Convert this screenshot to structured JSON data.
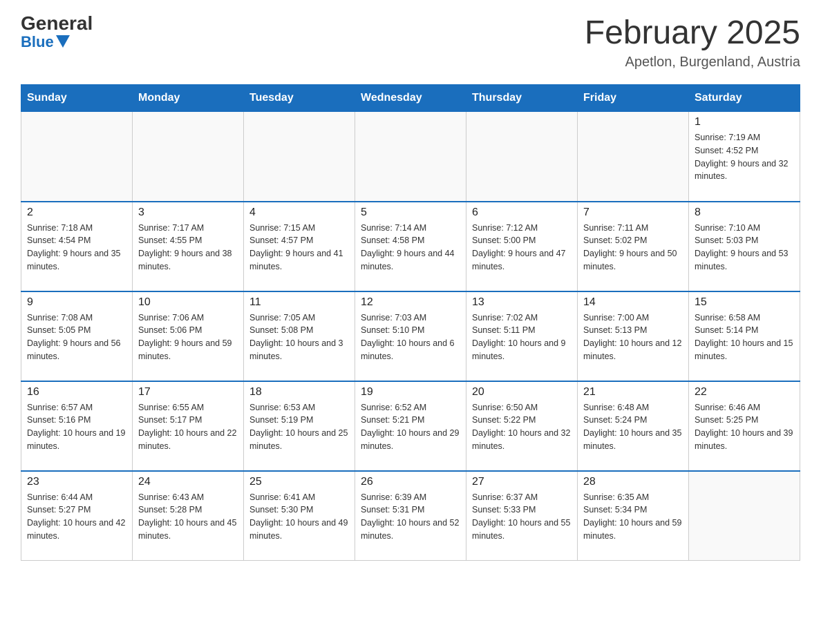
{
  "header": {
    "logo_general": "General",
    "logo_blue": "Blue",
    "month_title": "February 2025",
    "location": "Apetlon, Burgenland, Austria"
  },
  "days_of_week": [
    "Sunday",
    "Monday",
    "Tuesday",
    "Wednesday",
    "Thursday",
    "Friday",
    "Saturday"
  ],
  "weeks": [
    [
      {
        "day": "",
        "info": ""
      },
      {
        "day": "",
        "info": ""
      },
      {
        "day": "",
        "info": ""
      },
      {
        "day": "",
        "info": ""
      },
      {
        "day": "",
        "info": ""
      },
      {
        "day": "",
        "info": ""
      },
      {
        "day": "1",
        "info": "Sunrise: 7:19 AM\nSunset: 4:52 PM\nDaylight: 9 hours and 32 minutes."
      }
    ],
    [
      {
        "day": "2",
        "info": "Sunrise: 7:18 AM\nSunset: 4:54 PM\nDaylight: 9 hours and 35 minutes."
      },
      {
        "day": "3",
        "info": "Sunrise: 7:17 AM\nSunset: 4:55 PM\nDaylight: 9 hours and 38 minutes."
      },
      {
        "day": "4",
        "info": "Sunrise: 7:15 AM\nSunset: 4:57 PM\nDaylight: 9 hours and 41 minutes."
      },
      {
        "day": "5",
        "info": "Sunrise: 7:14 AM\nSunset: 4:58 PM\nDaylight: 9 hours and 44 minutes."
      },
      {
        "day": "6",
        "info": "Sunrise: 7:12 AM\nSunset: 5:00 PM\nDaylight: 9 hours and 47 minutes."
      },
      {
        "day": "7",
        "info": "Sunrise: 7:11 AM\nSunset: 5:02 PM\nDaylight: 9 hours and 50 minutes."
      },
      {
        "day": "8",
        "info": "Sunrise: 7:10 AM\nSunset: 5:03 PM\nDaylight: 9 hours and 53 minutes."
      }
    ],
    [
      {
        "day": "9",
        "info": "Sunrise: 7:08 AM\nSunset: 5:05 PM\nDaylight: 9 hours and 56 minutes."
      },
      {
        "day": "10",
        "info": "Sunrise: 7:06 AM\nSunset: 5:06 PM\nDaylight: 9 hours and 59 minutes."
      },
      {
        "day": "11",
        "info": "Sunrise: 7:05 AM\nSunset: 5:08 PM\nDaylight: 10 hours and 3 minutes."
      },
      {
        "day": "12",
        "info": "Sunrise: 7:03 AM\nSunset: 5:10 PM\nDaylight: 10 hours and 6 minutes."
      },
      {
        "day": "13",
        "info": "Sunrise: 7:02 AM\nSunset: 5:11 PM\nDaylight: 10 hours and 9 minutes."
      },
      {
        "day": "14",
        "info": "Sunrise: 7:00 AM\nSunset: 5:13 PM\nDaylight: 10 hours and 12 minutes."
      },
      {
        "day": "15",
        "info": "Sunrise: 6:58 AM\nSunset: 5:14 PM\nDaylight: 10 hours and 15 minutes."
      }
    ],
    [
      {
        "day": "16",
        "info": "Sunrise: 6:57 AM\nSunset: 5:16 PM\nDaylight: 10 hours and 19 minutes."
      },
      {
        "day": "17",
        "info": "Sunrise: 6:55 AM\nSunset: 5:17 PM\nDaylight: 10 hours and 22 minutes."
      },
      {
        "day": "18",
        "info": "Sunrise: 6:53 AM\nSunset: 5:19 PM\nDaylight: 10 hours and 25 minutes."
      },
      {
        "day": "19",
        "info": "Sunrise: 6:52 AM\nSunset: 5:21 PM\nDaylight: 10 hours and 29 minutes."
      },
      {
        "day": "20",
        "info": "Sunrise: 6:50 AM\nSunset: 5:22 PM\nDaylight: 10 hours and 32 minutes."
      },
      {
        "day": "21",
        "info": "Sunrise: 6:48 AM\nSunset: 5:24 PM\nDaylight: 10 hours and 35 minutes."
      },
      {
        "day": "22",
        "info": "Sunrise: 6:46 AM\nSunset: 5:25 PM\nDaylight: 10 hours and 39 minutes."
      }
    ],
    [
      {
        "day": "23",
        "info": "Sunrise: 6:44 AM\nSunset: 5:27 PM\nDaylight: 10 hours and 42 minutes."
      },
      {
        "day": "24",
        "info": "Sunrise: 6:43 AM\nSunset: 5:28 PM\nDaylight: 10 hours and 45 minutes."
      },
      {
        "day": "25",
        "info": "Sunrise: 6:41 AM\nSunset: 5:30 PM\nDaylight: 10 hours and 49 minutes."
      },
      {
        "day": "26",
        "info": "Sunrise: 6:39 AM\nSunset: 5:31 PM\nDaylight: 10 hours and 52 minutes."
      },
      {
        "day": "27",
        "info": "Sunrise: 6:37 AM\nSunset: 5:33 PM\nDaylight: 10 hours and 55 minutes."
      },
      {
        "day": "28",
        "info": "Sunrise: 6:35 AM\nSunset: 5:34 PM\nDaylight: 10 hours and 59 minutes."
      },
      {
        "day": "",
        "info": ""
      }
    ]
  ]
}
